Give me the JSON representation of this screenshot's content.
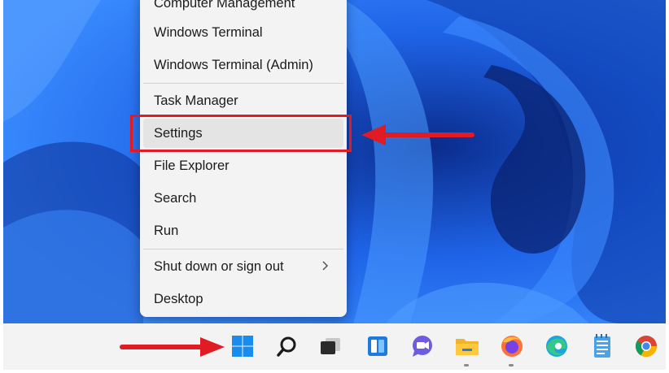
{
  "start_menu": {
    "items": [
      {
        "label": "Computer Management"
      },
      {
        "label": "Windows Terminal"
      },
      {
        "label": "Windows Terminal (Admin)"
      },
      {
        "label": "Task Manager"
      },
      {
        "label": "Settings"
      },
      {
        "label": "File Explorer"
      },
      {
        "label": "Search"
      },
      {
        "label": "Run"
      },
      {
        "label": "Shut down or sign out"
      },
      {
        "label": "Desktop"
      }
    ],
    "highlighted_item": "Settings",
    "submenu_chevron": "chevron-right-icon"
  },
  "annotations": {
    "highlight_color": "#e01b24",
    "arrow_color": "#e01b24"
  },
  "taskbar": {
    "icons": [
      "windows-start-icon",
      "search-icon",
      "task-view-icon",
      "widgets-icon",
      "chat-icon",
      "file-explorer-icon",
      "firefox-icon",
      "edge-icon",
      "notepad-icon",
      "chrome-icon"
    ]
  },
  "colors": {
    "wallpaper_primary": "#1d5fe0",
    "menu_background": "#f3f3f3",
    "taskbar_background": "#f3f3f3"
  }
}
